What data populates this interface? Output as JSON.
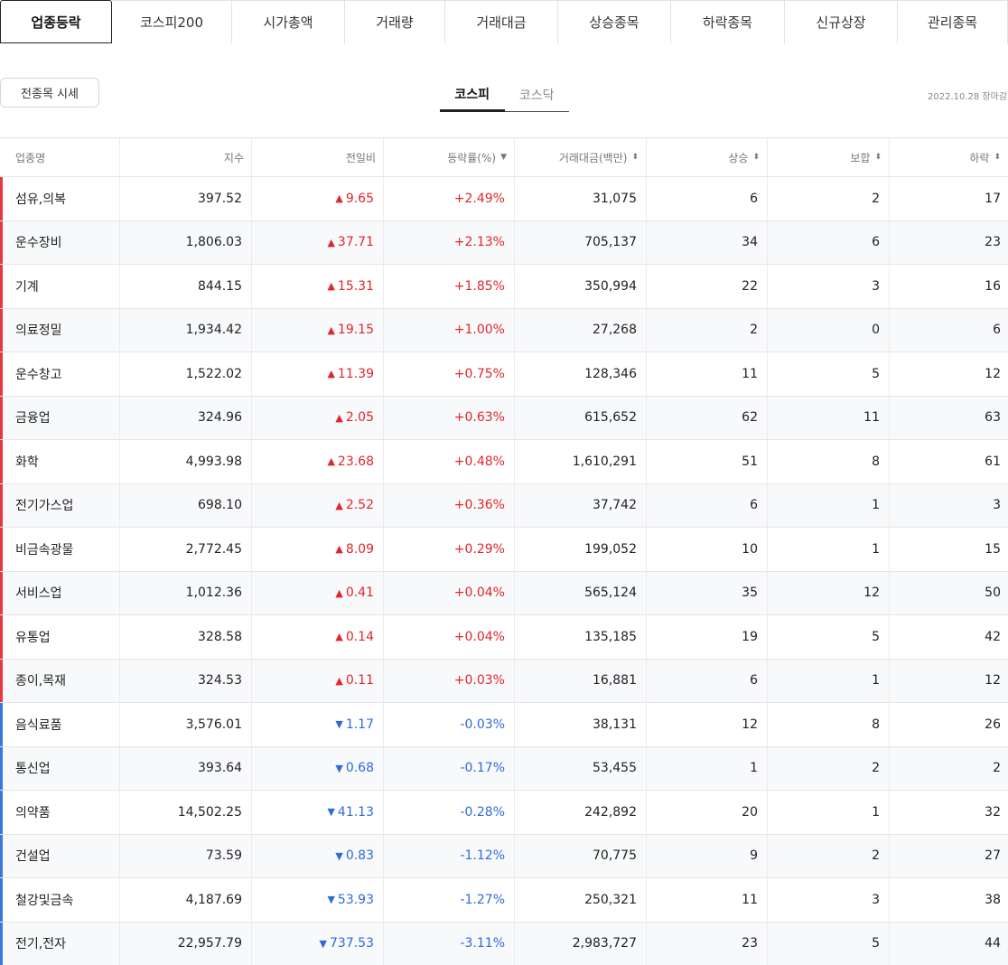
{
  "top_tabs": [
    {
      "label": "업종등락",
      "active": true,
      "width": 124
    },
    {
      "label": "코스피200",
      "active": false,
      "width": 133
    },
    {
      "label": "시가총액",
      "active": false,
      "width": 125
    },
    {
      "label": "거래량",
      "active": false,
      "width": 111
    },
    {
      "label": "거래대금",
      "active": false,
      "width": 125
    },
    {
      "label": "상승종목",
      "active": false,
      "width": 125
    },
    {
      "label": "하락종목",
      "active": false,
      "width": 126
    },
    {
      "label": "신규상장",
      "active": false,
      "width": 125
    },
    {
      "label": "관리종목",
      "active": false,
      "width": 122
    }
  ],
  "all_stocks_button": "전종목 시세",
  "market_tabs": [
    {
      "label": "코스피",
      "active": true
    },
    {
      "label": "코스닥",
      "active": false
    }
  ],
  "date_note": "2022.10.28 장마감",
  "table": {
    "headers": [
      {
        "label": "업종명",
        "sort": ""
      },
      {
        "label": "지수",
        "sort": ""
      },
      {
        "label": "전일비",
        "sort": ""
      },
      {
        "label": "등락률(%)",
        "sort": "▼"
      },
      {
        "label": "거래대금(백만)",
        "sort": "⬍"
      },
      {
        "label": "상승",
        "sort": "⬍"
      },
      {
        "label": "보합",
        "sort": "⬍"
      },
      {
        "label": "하락",
        "sort": "⬍"
      }
    ],
    "rows": [
      {
        "name": "섬유,의복",
        "index": "397.52",
        "dir": "up",
        "change": "9.65",
        "rate": "+2.49%",
        "amount": "31,075",
        "rise": "6",
        "flat": "2",
        "fall": "17"
      },
      {
        "name": "운수장비",
        "index": "1,806.03",
        "dir": "up",
        "change": "37.71",
        "rate": "+2.13%",
        "amount": "705,137",
        "rise": "34",
        "flat": "6",
        "fall": "23"
      },
      {
        "name": "기계",
        "index": "844.15",
        "dir": "up",
        "change": "15.31",
        "rate": "+1.85%",
        "amount": "350,994",
        "rise": "22",
        "flat": "3",
        "fall": "16"
      },
      {
        "name": "의료정밀",
        "index": "1,934.42",
        "dir": "up",
        "change": "19.15",
        "rate": "+1.00%",
        "amount": "27,268",
        "rise": "2",
        "flat": "0",
        "fall": "6"
      },
      {
        "name": "운수창고",
        "index": "1,522.02",
        "dir": "up",
        "change": "11.39",
        "rate": "+0.75%",
        "amount": "128,346",
        "rise": "11",
        "flat": "5",
        "fall": "12"
      },
      {
        "name": "금융업",
        "index": "324.96",
        "dir": "up",
        "change": "2.05",
        "rate": "+0.63%",
        "amount": "615,652",
        "rise": "62",
        "flat": "11",
        "fall": "63"
      },
      {
        "name": "화학",
        "index": "4,993.98",
        "dir": "up",
        "change": "23.68",
        "rate": "+0.48%",
        "amount": "1,610,291",
        "rise": "51",
        "flat": "8",
        "fall": "61"
      },
      {
        "name": "전기가스업",
        "index": "698.10",
        "dir": "up",
        "change": "2.52",
        "rate": "+0.36%",
        "amount": "37,742",
        "rise": "6",
        "flat": "1",
        "fall": "3"
      },
      {
        "name": "비금속광물",
        "index": "2,772.45",
        "dir": "up",
        "change": "8.09",
        "rate": "+0.29%",
        "amount": "199,052",
        "rise": "10",
        "flat": "1",
        "fall": "15"
      },
      {
        "name": "서비스업",
        "index": "1,012.36",
        "dir": "up",
        "change": "0.41",
        "rate": "+0.04%",
        "amount": "565,124",
        "rise": "35",
        "flat": "12",
        "fall": "50"
      },
      {
        "name": "유통업",
        "index": "328.58",
        "dir": "up",
        "change": "0.14",
        "rate": "+0.04%",
        "amount": "135,185",
        "rise": "19",
        "flat": "5",
        "fall": "42"
      },
      {
        "name": "종이,목재",
        "index": "324.53",
        "dir": "up",
        "change": "0.11",
        "rate": "+0.03%",
        "amount": "16,881",
        "rise": "6",
        "flat": "1",
        "fall": "12"
      },
      {
        "name": "음식료품",
        "index": "3,576.01",
        "dir": "down",
        "change": "1.17",
        "rate": "-0.03%",
        "amount": "38,131",
        "rise": "12",
        "flat": "8",
        "fall": "26"
      },
      {
        "name": "통신업",
        "index": "393.64",
        "dir": "down",
        "change": "0.68",
        "rate": "-0.17%",
        "amount": "53,455",
        "rise": "1",
        "flat": "2",
        "fall": "2"
      },
      {
        "name": "의약품",
        "index": "14,502.25",
        "dir": "down",
        "change": "41.13",
        "rate": "-0.28%",
        "amount": "242,892",
        "rise": "20",
        "flat": "1",
        "fall": "32"
      },
      {
        "name": "건설업",
        "index": "73.59",
        "dir": "down",
        "change": "0.83",
        "rate": "-1.12%",
        "amount": "70,775",
        "rise": "9",
        "flat": "2",
        "fall": "27"
      },
      {
        "name": "철강및금속",
        "index": "4,187.69",
        "dir": "down",
        "change": "53.93",
        "rate": "-1.27%",
        "amount": "250,321",
        "rise": "11",
        "flat": "3",
        "fall": "38"
      },
      {
        "name": "전기,전자",
        "index": "22,957.79",
        "dir": "down",
        "change": "737.53",
        "rate": "-3.11%",
        "amount": "2,983,727",
        "rise": "23",
        "flat": "5",
        "fall": "44"
      }
    ]
  },
  "colors": {
    "up": "#e0262b",
    "down": "#2f6bd8"
  },
  "icons": {
    "up": "triangle-up-icon",
    "down": "triangle-down-icon"
  }
}
